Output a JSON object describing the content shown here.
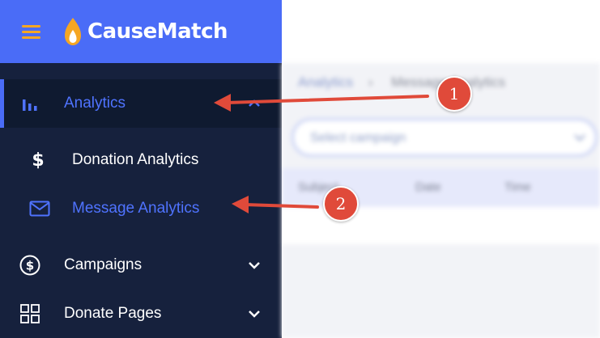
{
  "brand": {
    "name": "CauseMatch",
    "flame_color": "#f5a623"
  },
  "colors": {
    "sidebar_bg": "#16213d",
    "brand_bar": "#4a6cf7",
    "active_text": "#4f73ff",
    "annotation": "#e04a3a"
  },
  "sidebar": {
    "items": [
      {
        "label": "Analytics",
        "icon": "bar-chart-icon",
        "active": true,
        "expanded": true
      },
      {
        "label": "Donation Analytics",
        "icon": "dollar-icon",
        "sub": true
      },
      {
        "label": "Message Analytics",
        "icon": "envelope-icon",
        "sub": true,
        "highlight": true
      },
      {
        "label": "Campaigns",
        "icon": "dollar-circle-icon",
        "expandable": true
      },
      {
        "label": "Donate Pages",
        "icon": "grid-icon",
        "expandable": true
      }
    ]
  },
  "main": {
    "breadcrumb": [
      "Analytics",
      "Message Analytics"
    ],
    "select_placeholder": "Select campaign",
    "table_columns": [
      "Subject",
      "Date",
      "Time"
    ]
  },
  "annotations": [
    {
      "number": "1",
      "target": "Analytics"
    },
    {
      "number": "2",
      "target": "Message Analytics"
    }
  ]
}
